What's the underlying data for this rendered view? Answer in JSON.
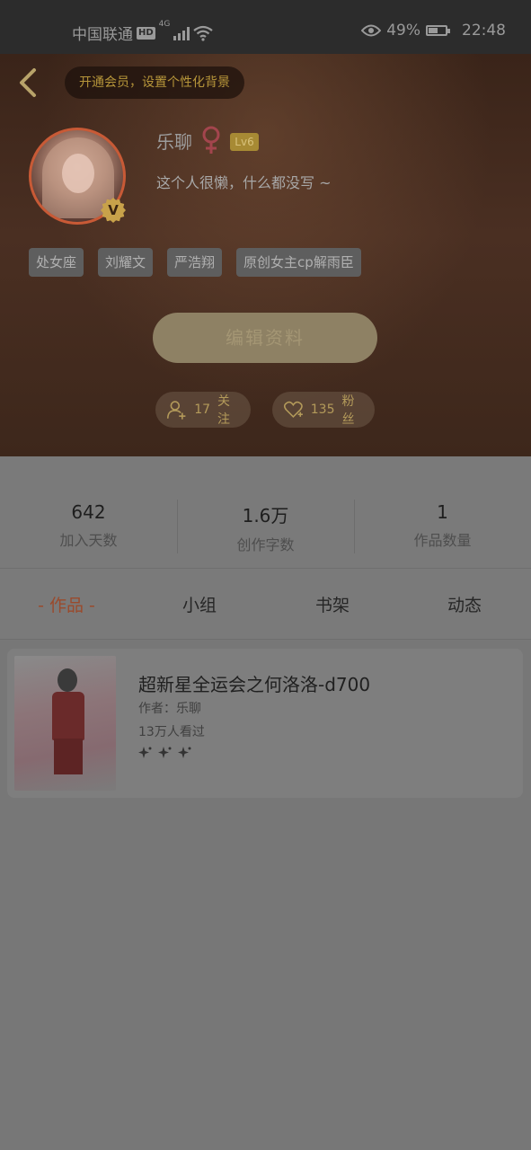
{
  "status_bar": {
    "carrier": "中国联通",
    "hd": "HD",
    "network": "4G",
    "battery": "49%",
    "time": "22:48"
  },
  "header": {
    "member_prompt": "开通会员，设置个性化背景",
    "username": "乐聊",
    "level": "Lv6",
    "vip_badge": "V",
    "signature": "这个人很懒，什么都没写 ~",
    "tags": [
      "处女座",
      "刘耀文",
      "严浩翔",
      "原创女主cp解雨臣"
    ],
    "edit_button": "编辑资料",
    "following": {
      "count": "17",
      "label": "关注"
    },
    "followers": {
      "count": "135",
      "label": "粉丝"
    }
  },
  "stats": [
    {
      "value": "642",
      "label": "加入天数"
    },
    {
      "value": "1.6万",
      "label": "创作字数"
    },
    {
      "value": "1",
      "label": "作品数量"
    }
  ],
  "tabs": [
    "- 作品 -",
    "小组",
    "书架",
    "动态"
  ],
  "active_tab": 0,
  "works": [
    {
      "title": "超新星全运会之何洛洛-d700",
      "author": "作者：乐聊",
      "views": "13万人看过"
    }
  ],
  "colors": {
    "accent_gold": "#b7963a",
    "active_tab": "#9a4a2c",
    "female": "#a3454d"
  }
}
